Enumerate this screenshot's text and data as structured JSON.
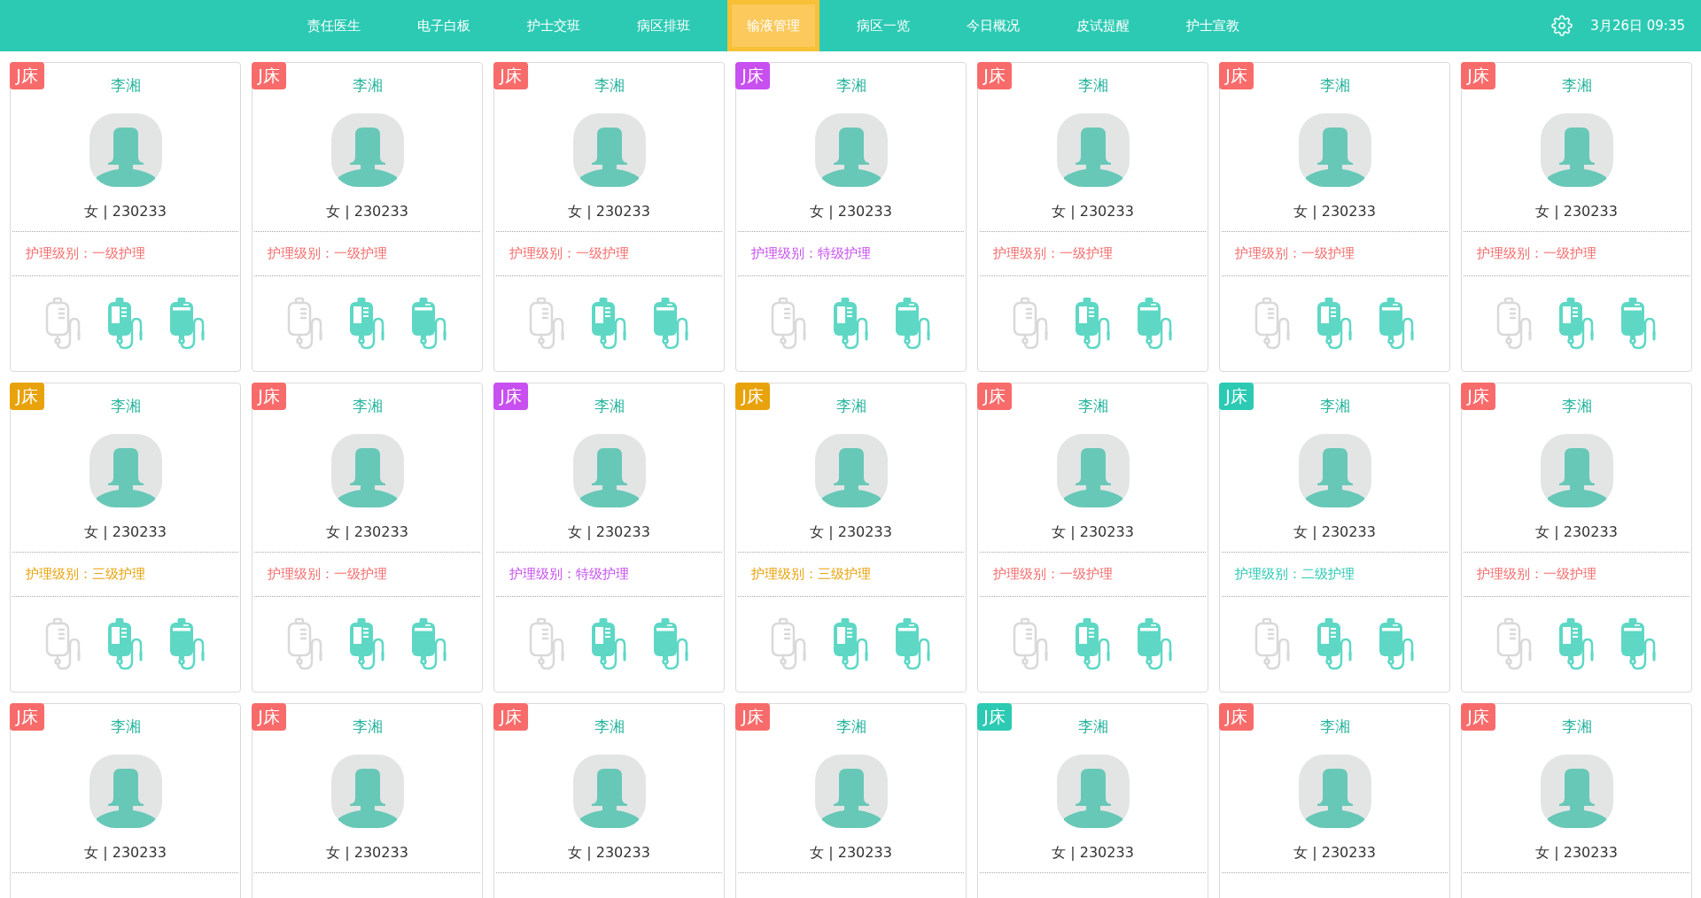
{
  "header": {
    "nav": [
      {
        "label": "责任医生",
        "selected": false
      },
      {
        "label": "电子白板",
        "selected": false
      },
      {
        "label": "护士交班",
        "selected": false
      },
      {
        "label": "病区排班",
        "selected": false
      },
      {
        "label": "输液管理",
        "selected": true
      },
      {
        "label": "病区一览",
        "selected": false
      },
      {
        "label": "今日概况",
        "selected": false
      },
      {
        "label": "皮试提醒",
        "selected": false
      },
      {
        "label": "护士宣教",
        "selected": false
      }
    ],
    "datetime": "3月26日 09:35"
  },
  "cards": [
    {
      "bed": "J床",
      "color": "#f86b6b",
      "name": "李湘",
      "info": "女 | 230233",
      "care_level": "护理级别：一级护理"
    },
    {
      "bed": "J床",
      "color": "#f86b6b",
      "name": "李湘",
      "info": "女 | 230233",
      "care_level": "护理级别：一级护理"
    },
    {
      "bed": "J床",
      "color": "#f86b6b",
      "name": "李湘",
      "info": "女 | 230233",
      "care_level": "护理级别：一级护理"
    },
    {
      "bed": "J床",
      "color": "#c84ff0",
      "name": "李湘",
      "info": "女 | 230233",
      "care_level": "护理级别：特级护理"
    },
    {
      "bed": "J床",
      "color": "#f86b6b",
      "name": "李湘",
      "info": "女 | 230233",
      "care_level": "护理级别：一级护理"
    },
    {
      "bed": "J床",
      "color": "#f86b6b",
      "name": "李湘",
      "info": "女 | 230233",
      "care_level": "护理级别：一级护理"
    },
    {
      "bed": "J床",
      "color": "#f86b6b",
      "name": "李湘",
      "info": "女 | 230233",
      "care_level": "护理级别：一级护理"
    },
    {
      "bed": "J床",
      "color": "#e8a30c",
      "name": "李湘",
      "info": "女 | 230233",
      "care_level": "护理级别：三级护理"
    },
    {
      "bed": "J床",
      "color": "#f86b6b",
      "name": "李湘",
      "info": "女 | 230233",
      "care_level": "护理级别：一级护理"
    },
    {
      "bed": "J床",
      "color": "#c84ff0",
      "name": "李湘",
      "info": "女 | 230233",
      "care_level": "护理级别：特级护理"
    },
    {
      "bed": "J床",
      "color": "#e8a30c",
      "name": "李湘",
      "info": "女 | 230233",
      "care_level": "护理级别：三级护理"
    },
    {
      "bed": "J床",
      "color": "#f86b6b",
      "name": "李湘",
      "info": "女 | 230233",
      "care_level": "护理级别：一级护理"
    },
    {
      "bed": "J床",
      "color": "#2ccab3",
      "name": "李湘",
      "info": "女 | 230233",
      "care_level": "护理级别：二级护理"
    },
    {
      "bed": "J床",
      "color": "#f86b6b",
      "name": "李湘",
      "info": "女 | 230233",
      "care_level": "护理级别：一级护理"
    },
    {
      "bed": "J床",
      "color": "#f86b6b",
      "name": "李湘",
      "info": "女 | 230233"
    },
    {
      "bed": "J床",
      "color": "#f86b6b",
      "name": "李湘",
      "info": "女 | 230233"
    },
    {
      "bed": "J床",
      "color": "#f86b6b",
      "name": "李湘",
      "info": "女 | 230233"
    },
    {
      "bed": "J床",
      "color": "#f86b6b",
      "name": "李湘",
      "info": "女 | 230233"
    },
    {
      "bed": "J床",
      "color": "#2ccab3",
      "name": "李湘",
      "info": "女 | 230233"
    },
    {
      "bed": "J床",
      "color": "#f86b6b",
      "name": "李湘",
      "info": "女 | 230233"
    },
    {
      "bed": "J床",
      "color": "#f86b6b",
      "name": "李湘",
      "info": "女 | 230233"
    }
  ]
}
